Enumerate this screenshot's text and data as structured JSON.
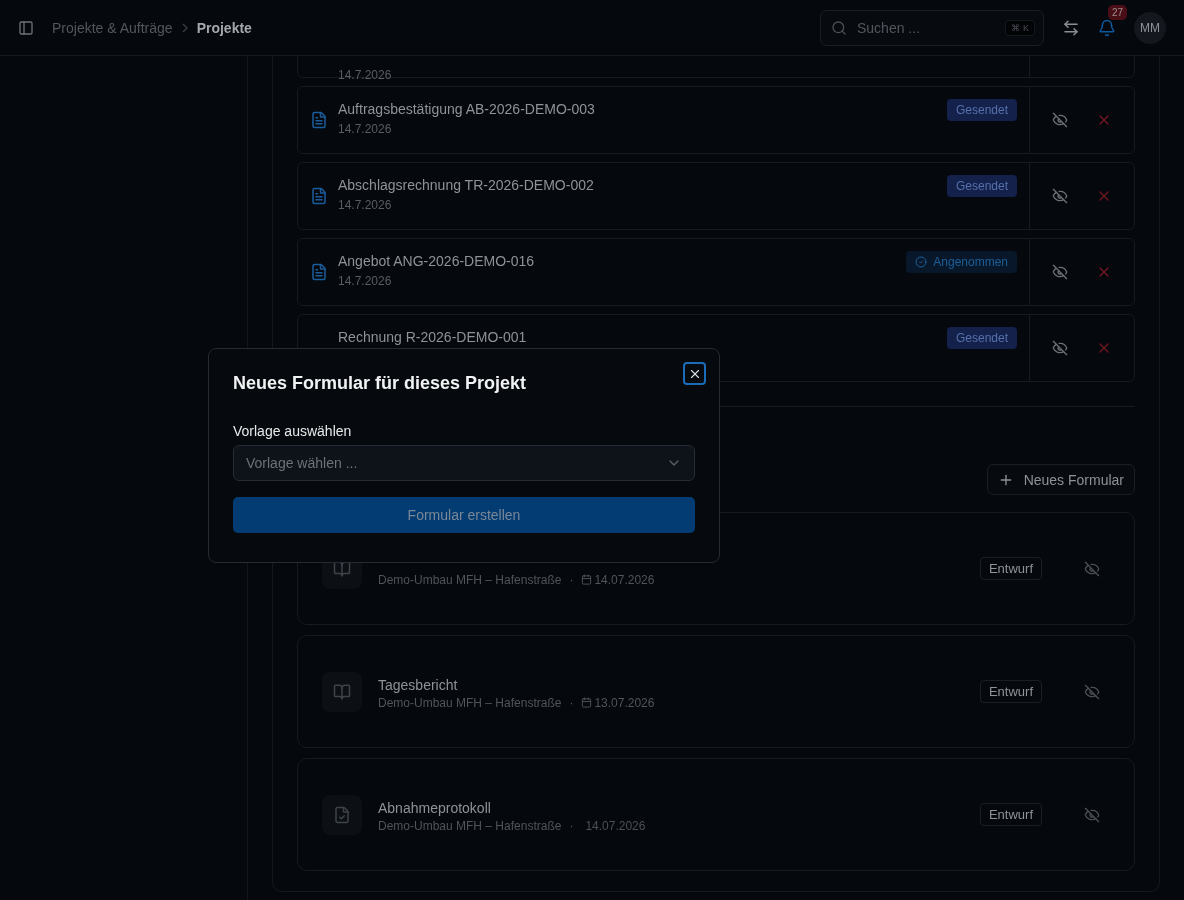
{
  "header": {
    "breadcrumbs": [
      {
        "label": "Projekte & Aufträge",
        "selected": false
      },
      {
        "label": "Projekte",
        "selected": true
      }
    ],
    "search": {
      "placeholder": "Suchen ...",
      "shortcut": "⌘ K"
    },
    "notifications": {
      "count": "27"
    },
    "avatar": "MM"
  },
  "documents": [
    {
      "date": "14.7.2026"
    },
    {
      "title": "Auftragsbestätigung AB-2026-DEMO-003",
      "date": "14.7.2026",
      "status": {
        "label": "Gesendet",
        "kind": "sent"
      }
    },
    {
      "title": "Abschlagsrechnung TR-2026-DEMO-002",
      "date": "14.7.2026",
      "status": {
        "label": "Gesendet",
        "kind": "sent"
      }
    },
    {
      "title": "Angebot ANG-2026-DEMO-016",
      "date": "14.7.2026",
      "status": {
        "label": "Angenommen",
        "kind": "accepted"
      }
    },
    {
      "title": "Rechnung R-2026-DEMO-001",
      "status": {
        "label": "Gesendet",
        "kind": "sent"
      }
    }
  ],
  "new_form_button": "Neues Formular",
  "forms": [
    {
      "kind": "report",
      "subtitle": "Demo-Umbau MFH – Hafenstraße",
      "separator": "·",
      "date": "14.07.2026",
      "calendar": true,
      "status": "Entwurf"
    },
    {
      "kind": "report",
      "title": "Tagesbericht",
      "subtitle": "Demo-Umbau MFH – Hafenstraße",
      "separator": "·",
      "date": "13.07.2026",
      "calendar": true,
      "status": "Entwurf"
    },
    {
      "kind": "protocol",
      "title": "Abnahmeprotokoll",
      "subtitle": "Demo-Umbau MFH – Hafenstraße",
      "separator": "·",
      "date": "14.07.2026",
      "calendar": false,
      "status": "Entwurf"
    }
  ],
  "modal": {
    "title": "Neues Formular für dieses Projekt",
    "field_label": "Vorlage auswählen",
    "select": {
      "placeholder": "Vorlage wählen ..."
    },
    "submit": {
      "label": "Formular erstellen",
      "disabled": true
    }
  }
}
